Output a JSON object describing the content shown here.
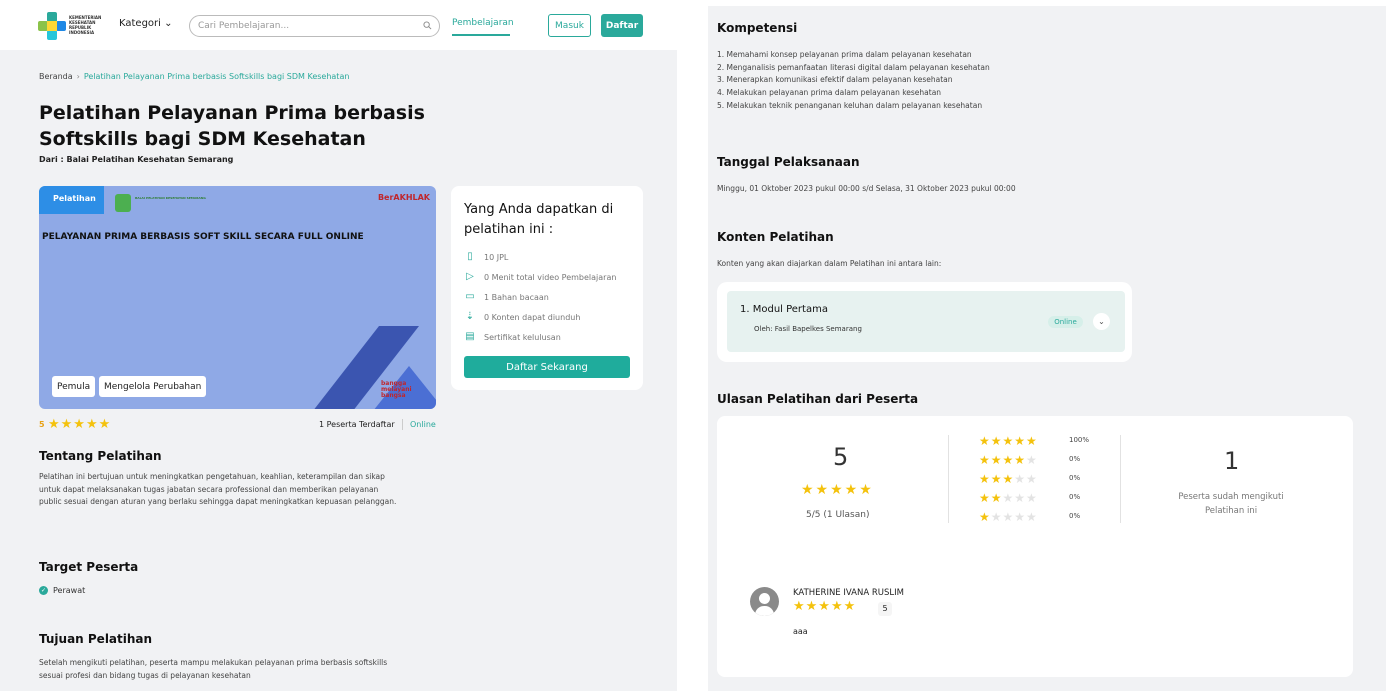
{
  "header": {
    "logo_text": "KEMENTERIAN KESEHATAN REPUBLIK INDONESIA",
    "kategori_label": "Kategori",
    "search_placeholder": "Cari Pembelajaran...",
    "nav_learning": "Pembelajaran",
    "login_label": "Masuk",
    "register_label": "Daftar",
    "accent_color": "#2aa99b"
  },
  "breadcrumb": {
    "home": "Beranda",
    "current": "Pelatihan Pelayanan Prima berbasis Softskills bagi SDM Kesehatan"
  },
  "course": {
    "title": "Pelatihan Pelayanan Prima berbasis Softskills bagi SDM Kesehatan",
    "from": "Dari : Balai Pelatihan Kesehatan Semarang",
    "banner_tag": "Pelatihan",
    "banner_title": "PELAYANAN PRIMA BERBASIS SOFT SKILL SECARA FULL ONLINE",
    "banner_brand": "BerAKHLAK",
    "banner_org": "BALAI PELATIHAN KESEHATAN SEMARANG",
    "banner_bangga": "bangga melayani bangsa",
    "chips": [
      "Pemula",
      "Mengelola Perubahan"
    ],
    "rating_value": "5",
    "participants": "1 Peserta Terdaftar",
    "mode": "Online"
  },
  "benefits": {
    "title": "Yang Anda dapatkan di pelatihan ini :",
    "items": [
      {
        "icon": "document-icon",
        "label": "10 JPL"
      },
      {
        "icon": "play-icon",
        "label": "0 Menit total video Pembelajaran"
      },
      {
        "icon": "book-icon",
        "label": "1 Bahan bacaan"
      },
      {
        "icon": "cloud-download-icon",
        "label": "0 Konten dapat diunduh"
      },
      {
        "icon": "certificate-icon",
        "label": "Sertifikat kelulusan"
      }
    ],
    "cta": "Daftar Sekarang"
  },
  "about": {
    "heading": "Tentang Pelatihan",
    "text": "Pelatihan ini bertujuan untuk meningkatkan pengetahuan, keahlian, keterampilan dan sikap untuk dapat melaksanakan tugas jabatan secara professional dan memberikan pelayanan public sesuai dengan aturan yang berlaku sehingga dapat meningkatkan kepuasan pelanggan."
  },
  "target": {
    "heading": "Target Peserta",
    "items": [
      "Perawat"
    ]
  },
  "goal": {
    "heading": "Tujuan Pelatihan",
    "text": "Setelah mengikuti pelatihan, peserta mampu melakukan pelayanan prima berbasis softskills sesuai profesi dan bidang tugas di pelayanan kesehatan"
  },
  "competency": {
    "heading": "Kompetensi",
    "items": [
      "1. Memahami konsep pelayanan prima dalam pelayanan kesehatan",
      "2. Menganalisis pemanfaatan literasi digital dalam pelayanan kesehatan",
      "3. Menerapkan komunikasi efektif dalam pelayanan kesehatan",
      "4. Melakukan pelayanan prima dalam pelayanan kesehatan",
      "5. Melakukan teknik penanganan keluhan dalam pelayanan kesehatan"
    ]
  },
  "schedule": {
    "heading": "Tanggal Pelaksanaan",
    "text": "Minggu, 01 Oktober 2023 pukul 00:00 s/d Selasa, 31 Oktober 2023 pukul 00:00"
  },
  "content": {
    "heading": "Konten Pelatihan",
    "intro": "Konten yang akan diajarkan dalam Pelatihan ini antara lain:",
    "modules": [
      {
        "title": "1. Modul Pertama",
        "by": "Oleh: Fasil Bapelkes Semarang",
        "badge": "Online"
      }
    ]
  },
  "reviews": {
    "heading": "Ulasan Pelatihan dari Peserta",
    "average": "5",
    "average_score": "5/5 (1 Ulasan)",
    "distribution": [
      {
        "stars": 5,
        "percent": "100%"
      },
      {
        "stars": 4,
        "percent": "0%"
      },
      {
        "stars": 3,
        "percent": "0%"
      },
      {
        "stars": 2,
        "percent": "0%"
      },
      {
        "stars": 1,
        "percent": "0%"
      }
    ],
    "completed_count": "1",
    "completed_label": "Peserta sudah mengikuti Pelatihan ini",
    "items": [
      {
        "name": "KATHERINE IVANA RUSLIM",
        "rating": "5",
        "text": "aaa"
      }
    ]
  }
}
